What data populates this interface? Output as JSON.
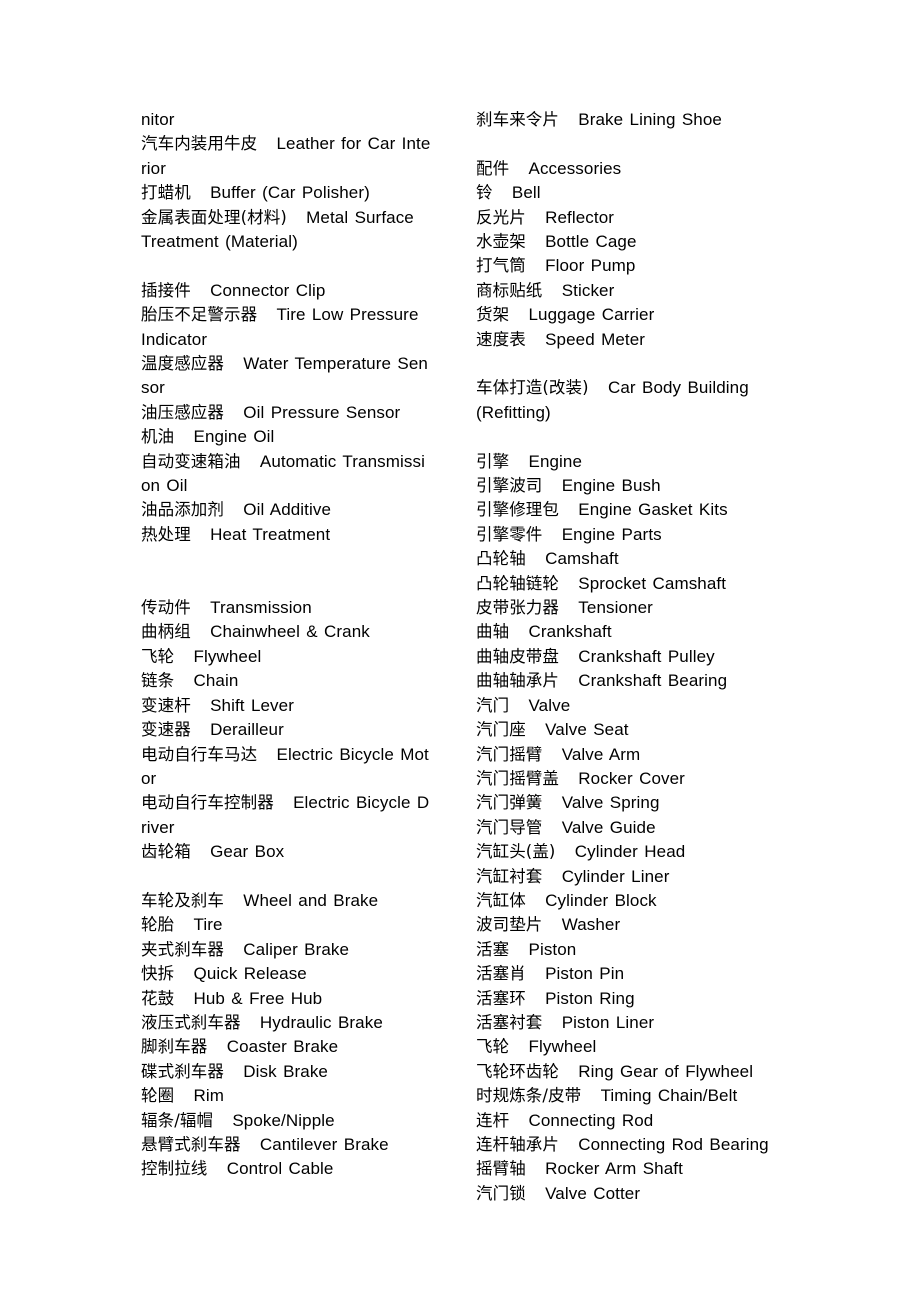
{
  "document": {
    "type": "bilingual-glossary",
    "language_pair": "Chinese-English",
    "subject": "Automotive and bicycle parts terminology",
    "columns": 2
  },
  "left_column": {
    "entries": [
      {
        "zh": "",
        "en": "nitor",
        "continuation": true
      },
      {
        "zh": "汽车内装用牛皮",
        "en": "Leather for Car Inte"
      },
      {
        "zh": "",
        "en": "rior",
        "continuation": true
      },
      {
        "zh": "打蜡机",
        "en": "Buffer (Car Polisher)"
      },
      {
        "zh": "金属表面处理(材料)",
        "en": "Metal Surface"
      },
      {
        "zh": "",
        "en": "Treatment (Material)",
        "continuation": true
      },
      {
        "blank": true
      },
      {
        "zh": "插接件",
        "en": "Connector Clip"
      },
      {
        "zh": "胎压不足警示器",
        "en": "Tire Low Pressure"
      },
      {
        "zh": "",
        "en": "Indicator",
        "continuation": true
      },
      {
        "zh": "温度感应器",
        "en": "Water Temperature Sen"
      },
      {
        "zh": "",
        "en": "sor",
        "continuation": true
      },
      {
        "zh": "油压感应器",
        "en": "Oil Pressure Sensor"
      },
      {
        "zh": "机油",
        "en": "Engine Oil"
      },
      {
        "zh": "自动变速箱油",
        "en": "Automatic Transmissi"
      },
      {
        "zh": "",
        "en": "on Oil",
        "continuation": true
      },
      {
        "zh": "油品添加剂",
        "en": "Oil Additive"
      },
      {
        "zh": "热处理",
        "en": "Heat Treatment"
      },
      {
        "blank": true
      },
      {
        "blank": true
      },
      {
        "zh": "传动件",
        "en": "Transmission"
      },
      {
        "zh": "曲柄组",
        "en": "Chainwheel & Crank"
      },
      {
        "zh": "飞轮",
        "en": "Flywheel"
      },
      {
        "zh": "链条",
        "en": "Chain"
      },
      {
        "zh": "变速杆",
        "en": "Shift Lever"
      },
      {
        "zh": "变速器",
        "en": "Derailleur"
      },
      {
        "zh": "电动自行车马达",
        "en": "Electric Bicycle Mot"
      },
      {
        "zh": "",
        "en": "or",
        "continuation": true
      },
      {
        "zh": "电动自行车控制器",
        "en": "Electric Bicycle D"
      },
      {
        "zh": "",
        "en": "river",
        "continuation": true
      },
      {
        "zh": "齿轮箱",
        "en": "Gear Box"
      },
      {
        "blank": true
      },
      {
        "zh": "车轮及刹车",
        "en": "Wheel and Brake"
      },
      {
        "zh": "轮胎",
        "en": "Tire"
      },
      {
        "zh": "夹式刹车器",
        "en": "Caliper Brake"
      },
      {
        "zh": "快拆",
        "en": "Quick Release"
      },
      {
        "zh": "花鼓",
        "en": "Hub & Free Hub"
      },
      {
        "zh": "液压式刹车器",
        "en": "Hydraulic Brake"
      },
      {
        "zh": "脚刹车器",
        "en": "Coaster Brake"
      },
      {
        "zh": "碟式刹车器",
        "en": "Disk Brake"
      },
      {
        "zh": "轮圈",
        "en": "Rim"
      },
      {
        "zh": "辐条/辐帽",
        "en": "Spoke/Nipple"
      },
      {
        "zh": "悬臂式刹车器",
        "en": "Cantilever Brake"
      },
      {
        "zh": "控制拉线",
        "en": "Control Cable"
      }
    ]
  },
  "right_column": {
    "entries": [
      {
        "zh": "刹车来令片",
        "en": "Brake Lining Shoe"
      },
      {
        "blank": true
      },
      {
        "zh": "配件",
        "en": "Accessories"
      },
      {
        "zh": "铃",
        "en": "Bell"
      },
      {
        "zh": "反光片",
        "en": "Reflector"
      },
      {
        "zh": "水壶架",
        "en": "Bottle Cage"
      },
      {
        "zh": "打气筒",
        "en": "Floor Pump"
      },
      {
        "zh": "商标贴纸",
        "en": "Sticker"
      },
      {
        "zh": "货架",
        "en": "Luggage Carrier"
      },
      {
        "zh": "速度表",
        "en": "Speed Meter"
      },
      {
        "blank": true
      },
      {
        "zh": "车体打造(改装)",
        "en": "Car Body Building"
      },
      {
        "zh": "",
        "en": "(Refitting)",
        "continuation": true
      },
      {
        "blank": true
      },
      {
        "zh": "引擎",
        "en": "Engine"
      },
      {
        "zh": "引擎波司",
        "en": "Engine Bush"
      },
      {
        "zh": "引擎修理包",
        "en": "Engine Gasket Kits"
      },
      {
        "zh": "引擎零件",
        "en": "Engine Parts"
      },
      {
        "zh": "凸轮轴",
        "en": "Camshaft"
      },
      {
        "zh": "凸轮轴链轮",
        "en": "Sprocket Camshaft"
      },
      {
        "zh": "皮带张力器",
        "en": "Tensioner"
      },
      {
        "zh": "曲轴",
        "en": "Crankshaft"
      },
      {
        "zh": "曲轴皮带盘",
        "en": "Crankshaft Pulley"
      },
      {
        "zh": "曲轴轴承片",
        "en": "Crankshaft Bearing"
      },
      {
        "zh": "汽门",
        "en": "Valve"
      },
      {
        "zh": "汽门座",
        "en": "Valve Seat"
      },
      {
        "zh": "汽门摇臂",
        "en": "Valve Arm"
      },
      {
        "zh": "汽门摇臂盖",
        "en": "Rocker Cover"
      },
      {
        "zh": "汽门弹簧",
        "en": "Valve Spring"
      },
      {
        "zh": "汽门导管",
        "en": "Valve Guide"
      },
      {
        "zh": "汽缸头(盖)",
        "en": "Cylinder Head"
      },
      {
        "zh": "汽缸衬套",
        "en": "Cylinder Liner"
      },
      {
        "zh": "汽缸体",
        "en": "Cylinder Block"
      },
      {
        "zh": "波司垫片",
        "en": "Washer"
      },
      {
        "zh": "活塞",
        "en": "Piston"
      },
      {
        "zh": "活塞肖",
        "en": "Piston Pin"
      },
      {
        "zh": "活塞环",
        "en": "Piston Ring"
      },
      {
        "zh": "活塞衬套",
        "en": "Piston Liner"
      },
      {
        "zh": "飞轮",
        "en": "Flywheel"
      },
      {
        "zh": "飞轮环齿轮",
        "en": "Ring Gear of Flywheel"
      },
      {
        "zh": "时规炼条/皮带",
        "en": "Timing Chain/Belt"
      },
      {
        "zh": "连杆",
        "en": "Connecting Rod"
      },
      {
        "zh": "连杆轴承片",
        "en": "Connecting Rod Bearing"
      },
      {
        "zh": "摇臂轴",
        "en": "Rocker Arm Shaft"
      },
      {
        "zh": "汽门锁",
        "en": "Valve Cotter"
      }
    ]
  },
  "separator": "    "
}
